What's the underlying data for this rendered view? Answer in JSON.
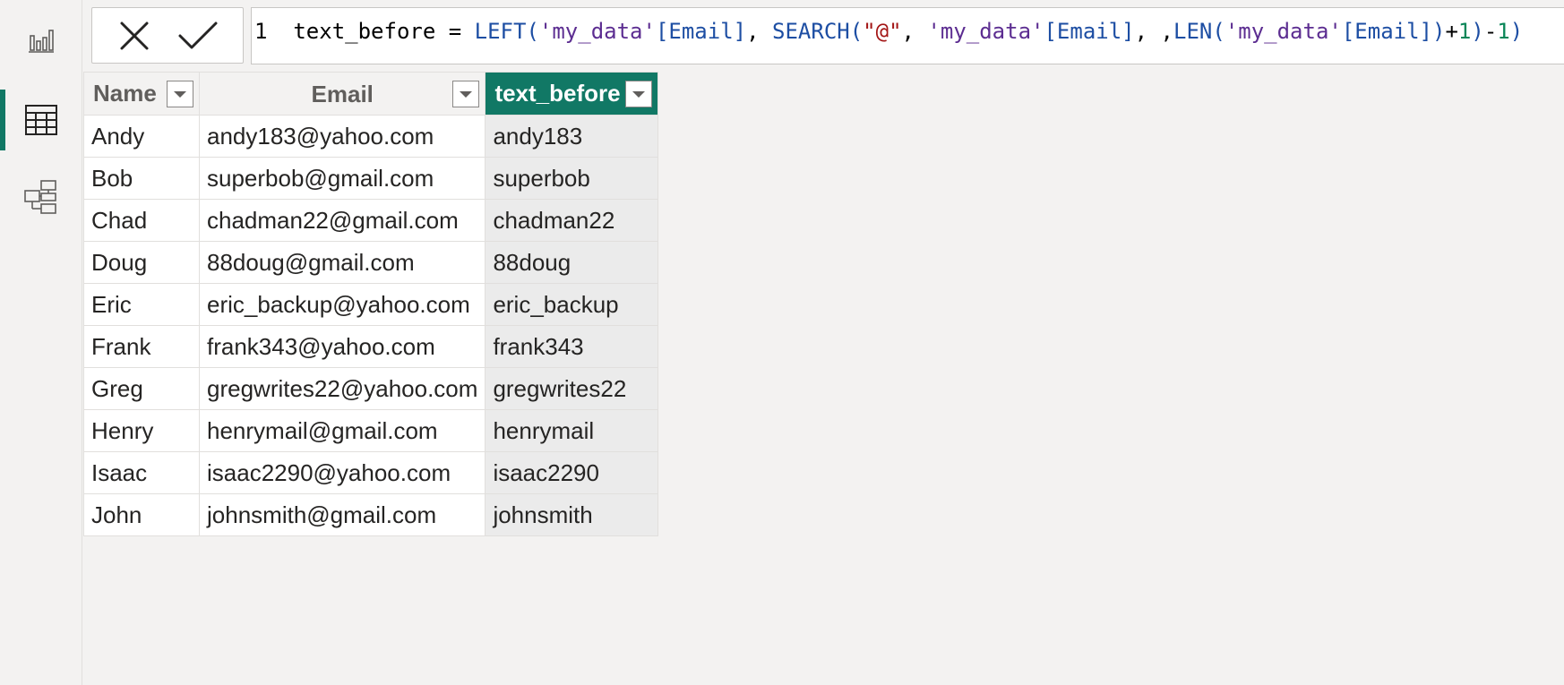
{
  "formula_bar": {
    "line_number": "1",
    "tokens": [
      {
        "t": "text_before = ",
        "c": "f-plain"
      },
      {
        "t": "LEFT",
        "c": "f-fn"
      },
      {
        "t": "(",
        "c": "f-paren"
      },
      {
        "t": "'my_data'",
        "c": "f-tbl"
      },
      {
        "t": "[Email]",
        "c": "f-col"
      },
      {
        "t": ", ",
        "c": "f-plain"
      },
      {
        "t": "SEARCH",
        "c": "f-fn"
      },
      {
        "t": "(",
        "c": "f-paren"
      },
      {
        "t": "\"@\"",
        "c": "f-str"
      },
      {
        "t": ", ",
        "c": "f-plain"
      },
      {
        "t": "'my_data'",
        "c": "f-tbl"
      },
      {
        "t": "[Email]",
        "c": "f-col"
      },
      {
        "t": ", ,",
        "c": "f-plain"
      },
      {
        "t": "LEN",
        "c": "f-fn"
      },
      {
        "t": "(",
        "c": "f-paren"
      },
      {
        "t": "'my_data'",
        "c": "f-tbl"
      },
      {
        "t": "[Email]",
        "c": "f-col"
      },
      {
        "t": ")",
        "c": "f-paren"
      },
      {
        "t": "+",
        "c": "f-plain"
      },
      {
        "t": "1",
        "c": "f-num"
      },
      {
        "t": ")",
        "c": "f-paren"
      },
      {
        "t": "-",
        "c": "f-plain"
      },
      {
        "t": "1",
        "c": "f-num"
      },
      {
        "t": ")",
        "c": "f-paren"
      }
    ]
  },
  "sidebar": {
    "items": [
      {
        "name": "report-view-icon"
      },
      {
        "name": "table-view-icon",
        "active": true
      },
      {
        "name": "model-view-icon"
      }
    ]
  },
  "table": {
    "columns": [
      "Name",
      "Email",
      "text_before"
    ],
    "rows": [
      [
        "Andy",
        "andy183@yahoo.com",
        "andy183"
      ],
      [
        "Bob",
        "superbob@gmail.com",
        "superbob"
      ],
      [
        "Chad",
        "chadman22@gmail.com",
        "chadman22"
      ],
      [
        "Doug",
        "88doug@gmail.com",
        "88doug"
      ],
      [
        "Eric",
        "eric_backup@yahoo.com",
        "eric_backup"
      ],
      [
        "Frank",
        "frank343@yahoo.com",
        "frank343"
      ],
      [
        "Greg",
        "gregwrites22@yahoo.com",
        "gregwrites22"
      ],
      [
        "Henry",
        "henrymail@gmail.com",
        "henrymail"
      ],
      [
        "Isaac",
        "isaac2290@yahoo.com",
        "isaac2290"
      ],
      [
        "John",
        "johnsmith@gmail.com",
        "johnsmith"
      ]
    ]
  },
  "colors": {
    "accent": "#117865",
    "selected_column_cells": "#ebebeb"
  }
}
